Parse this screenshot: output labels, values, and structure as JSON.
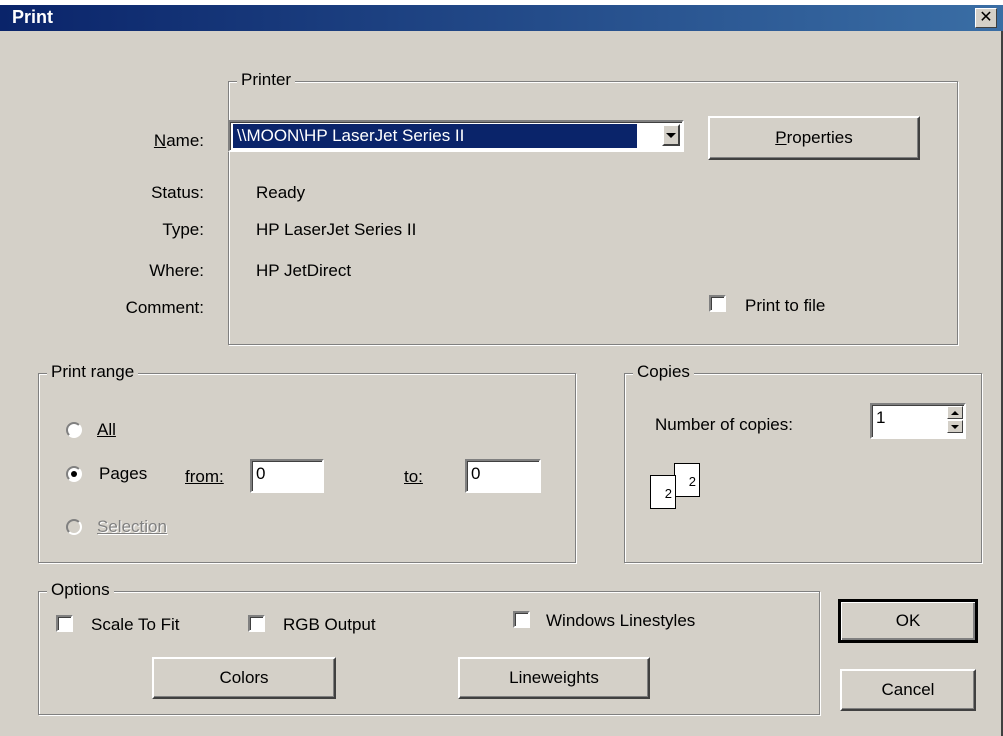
{
  "window": {
    "title": "Print",
    "close_glyph": "✕"
  },
  "printer": {
    "group_label": "Printer",
    "name_label": "Name:",
    "name_value": "\\\\MOON\\HP LaserJet Series II",
    "properties_button": "Properties",
    "status_label": "Status:",
    "status_value": "Ready",
    "type_label": "Type:",
    "type_value": "HP LaserJet Series II",
    "where_label": "Where:",
    "where_value": "HP JetDirect",
    "comment_label": "Comment:",
    "print_to_file_label": "Print to file",
    "print_to_file_checked": false
  },
  "print_range": {
    "group_label": "Print range",
    "all_label": "All",
    "pages_label": "Pages",
    "from_label": "from:",
    "from_value": "0",
    "to_label": "to:",
    "to_value": "0",
    "selection_label": "Selection",
    "selected": "Pages"
  },
  "copies": {
    "group_label": "Copies",
    "number_label": "Number of copies:",
    "number_value": "1",
    "page_numbers": [
      "2",
      "2"
    ]
  },
  "options": {
    "group_label": "Options",
    "scale_to_fit": "Scale To Fit",
    "rgb_output": "RGB Output",
    "windows_linestyles": "Windows Linestyles",
    "colors_button": "Colors",
    "lineweights_button": "Lineweights"
  },
  "buttons": {
    "ok": "OK",
    "cancel": "Cancel"
  },
  "colors": {
    "title_bar": "#0a246a",
    "dialog_bg": "#d4d0c8",
    "selection": "#0a246a"
  },
  "icons": {
    "close": "close-icon",
    "dropdown": "chevron-down-icon",
    "spin": "spinner-arrows-icon",
    "collate": "collate-pages-icon"
  }
}
